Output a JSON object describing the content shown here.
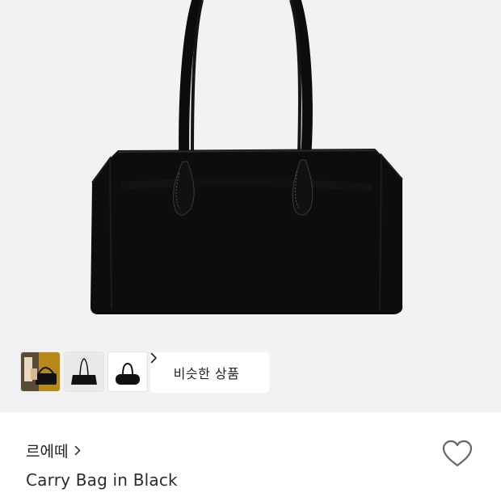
{
  "product": {
    "brand": "르에떼",
    "title": "Carry Bag in Black"
  },
  "gallery": {
    "thumbnails": [
      {
        "label": "thumbnail-lifestyle"
      },
      {
        "label": "thumbnail-bag-flat"
      },
      {
        "label": "thumbnail-bag-side"
      }
    ],
    "similar_products_label": "비슷한 상품"
  },
  "icons": {
    "brand_chevron": "chevron-right-icon",
    "similar_chevron": "chevron-right-icon",
    "wishlist": "heart-icon"
  },
  "colors": {
    "hero_background": "#f2f2f2",
    "bag": "#0d0d0d",
    "text_primary": "#222222",
    "icon_gray": "#666666"
  }
}
